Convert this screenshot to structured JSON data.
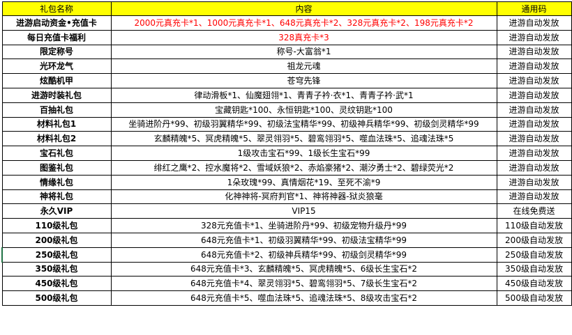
{
  "headers": [
    "礼包名称",
    "内容",
    "通用码"
  ],
  "colors": {
    "header_bg": "#ffff00",
    "highlight_text": "#ff0000",
    "selection_border": "#217346"
  },
  "rows": [
    {
      "name": "进游启动资金•充值卡",
      "content": "2000元真充卡*1、1000元真充卡*1、648元真充卡*2、328元真充卡*2、198元真充卡*2",
      "code": "进游自动发放",
      "highlight": true
    },
    {
      "name": "每日充值卡福利",
      "content": "328真充卡*3",
      "code": "进游自动发放",
      "highlight": true
    },
    {
      "name": "限定称号",
      "content": "称号-大富翁*1",
      "code": "进游自动发放"
    },
    {
      "name": "光环龙气",
      "content": "祖龙元魂",
      "code": "进游自动发放"
    },
    {
      "name": "炫酷机甲",
      "content": "苍穹先锋",
      "code": "进游自动发放"
    },
    {
      "name": "进游时装礼包",
      "content": "律动滑板*1、仙魔翅翎*1、青青子衿·衣*1、青青子衿·武*1",
      "code": "进游自动发放"
    },
    {
      "name": "百抽礼包",
      "content": "宝藏钥匙*100、永恒钥匙*100、灵纹钥匙*100",
      "code": "进游自动发放"
    },
    {
      "name": "材料礼包1",
      "content": "坐骑进阶丹*99、初级羽翼精华*99、初级法宝精华*99、初级神兵精华*99、初级剑灵精华*99",
      "code": "进游自动发放"
    },
    {
      "name": "材料礼包2",
      "content": "玄麟精魄*5、冥虎精魄*5、翠灵翎羽*5、碧鸾翎羽*5、噬血法珠*5、追魂法珠*5",
      "code": "进游自动发放"
    },
    {
      "name": "宝石礼包",
      "content": "1级攻击宝石*99、1级长生宝石*99",
      "code": "进游自动发放"
    },
    {
      "name": "图鉴礼包",
      "content": "绯红之鹰*2、控水魔将*2、雪域妖狼*2、赤焰豪猪*2、潮汐勇士*2、碧绿荧光*2",
      "code": "进游自动发放"
    },
    {
      "name": "情缘礼包",
      "content": "1朵玫瑰*99、真情烟花*19、至死不渝*9",
      "code": "进游自动发放"
    },
    {
      "name": "神将礼包",
      "content": "化神神将-冥府判官*1、神将神器-狱炎狼毫",
      "code": "进游自动发放"
    },
    {
      "name": "永久VIP",
      "content": "VIP15",
      "code": "在线免费送"
    },
    {
      "name": "110级礼包",
      "content": "328元充值卡*1、坐骑进阶丹*99、初级宠物升级丹*99",
      "code": "110级自动发放"
    },
    {
      "name": "200级礼包",
      "content": "648元充值卡*1、初级羽翼精华*99、初级法宝精华*99",
      "code": "200级自动发放"
    },
    {
      "name": "250级礼包",
      "content": "648元充值卡*2、初级神兵精华*99、初级剑灵精华*99",
      "code": "250级自动发放",
      "selected": true
    },
    {
      "name": "350级礼包",
      "content": "648元充值卡*3、玄麟精魄*5、冥虎精魄*5、6级长生宝石*2",
      "code": "350级自动发放"
    },
    {
      "name": "450级礼包",
      "content": "648元充值卡*4、翠灵翎羽*5、碧鸾翎羽*5、7级长生宝石*2",
      "code": "450级自动发放"
    },
    {
      "name": "500级礼包",
      "content": "648元充值卡*5、噬血法珠*5、追魂法珠*5、8级攻击宝石*2",
      "code": "500级自动发放"
    }
  ]
}
